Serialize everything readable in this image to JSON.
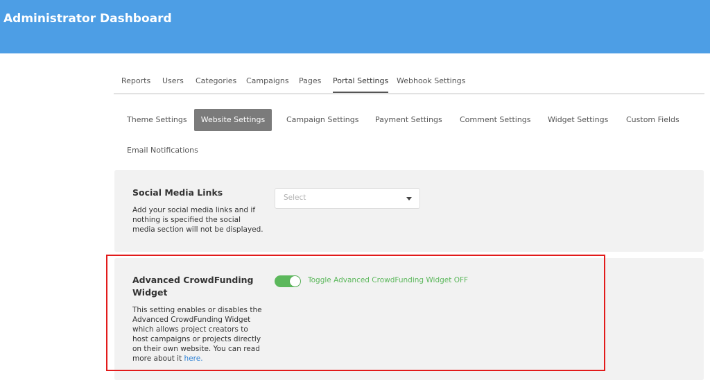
{
  "header": {
    "title": "Administrator Dashboard"
  },
  "main_tabs": [
    {
      "label": "Reports"
    },
    {
      "label": "Users"
    },
    {
      "label": "Categories"
    },
    {
      "label": "Campaigns"
    },
    {
      "label": "Pages"
    },
    {
      "label": "Portal Settings",
      "active": true
    },
    {
      "label": "Webhook Settings"
    }
  ],
  "sub_tabs": [
    {
      "label": "Theme Settings"
    },
    {
      "label": "Website Settings",
      "active": true
    },
    {
      "label": "Campaign Settings"
    },
    {
      "label": "Payment Settings"
    },
    {
      "label": "Comment Settings"
    },
    {
      "label": "Widget Settings"
    },
    {
      "label": "Custom Fields"
    },
    {
      "label": "Email Notifications"
    }
  ],
  "social_media": {
    "title": "Social Media Links",
    "description": "Add your social media links and if nothing is specified the social media section will not be displayed.",
    "select_placeholder": "Select"
  },
  "crowdfunding": {
    "title": "Advanced CrowdFunding Widget",
    "description": "This setting enables or disables the Advanced CrowdFunding Widget which allows project creators to host campaigns or projects directly on their own website. You can read more about it",
    "link_text": "here.",
    "toggle_label": "Toggle Advanced CrowdFunding Widget OFF",
    "toggle_on": true
  },
  "colors": {
    "header": "#4d9ee5",
    "active_subtab": "#7b7b7b",
    "toggle": "#5cb85c",
    "highlight": "#e21b1b",
    "link": "#2a7fd4"
  }
}
